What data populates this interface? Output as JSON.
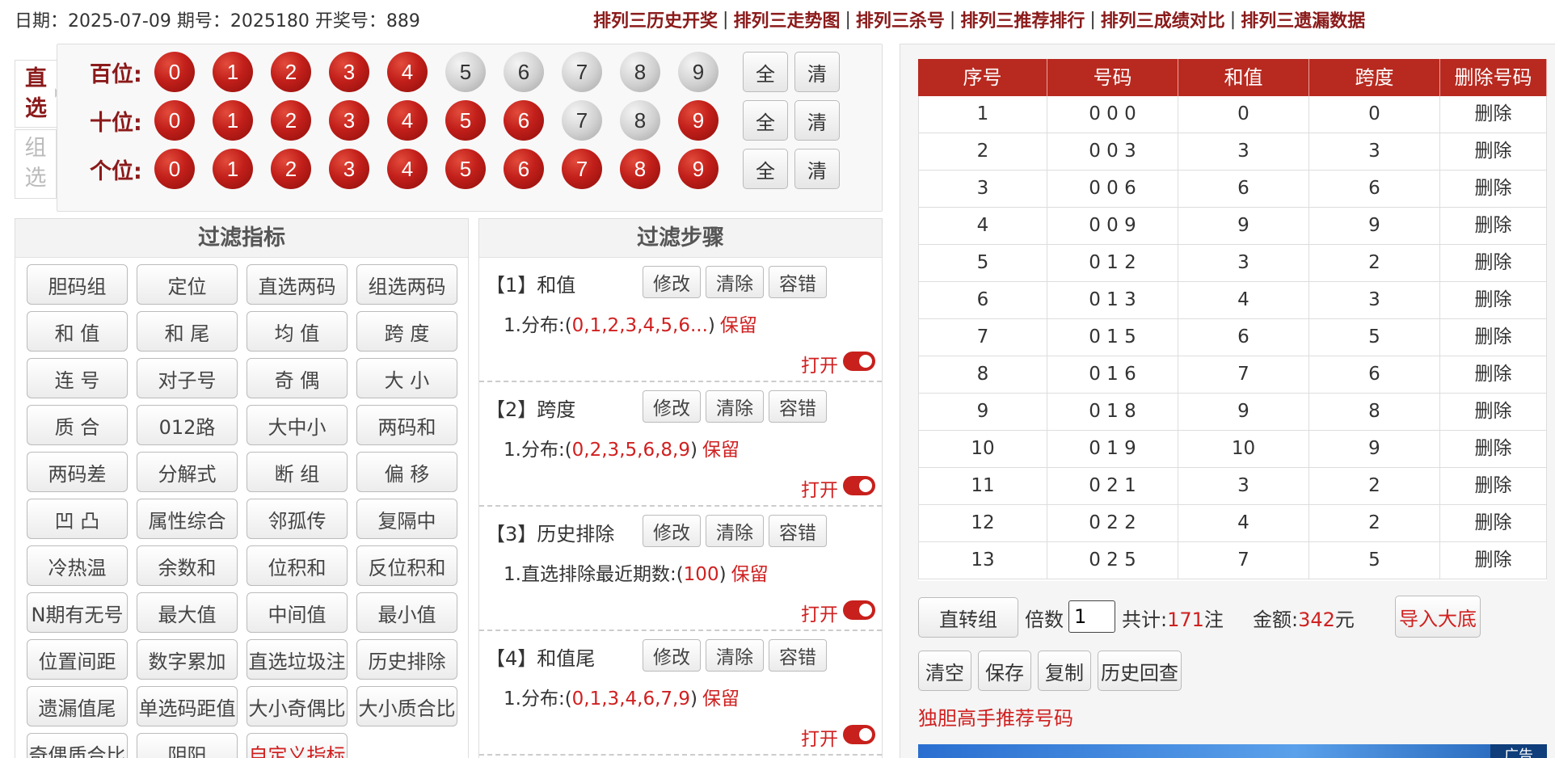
{
  "header": {
    "info": "日期：2025-07-09 期号：2025180 开奖号：889",
    "links": [
      "排列三历史开奖",
      "排列三走势图",
      "排列三杀号",
      "排列三推荐排行",
      "排列三成绩对比",
      "排列三遗漏数据"
    ]
  },
  "mode_tabs": {
    "direct": "直\n选",
    "group": "组\n选"
  },
  "picker": {
    "rows": [
      {
        "label": "百位:",
        "balls": [
          {
            "n": "0",
            "on": true
          },
          {
            "n": "1",
            "on": true
          },
          {
            "n": "2",
            "on": true
          },
          {
            "n": "3",
            "on": true
          },
          {
            "n": "4",
            "on": true
          },
          {
            "n": "5",
            "on": false
          },
          {
            "n": "6",
            "on": false
          },
          {
            "n": "7",
            "on": false
          },
          {
            "n": "8",
            "on": false
          },
          {
            "n": "9",
            "on": false
          }
        ]
      },
      {
        "label": "十位:",
        "balls": [
          {
            "n": "0",
            "on": true
          },
          {
            "n": "1",
            "on": true
          },
          {
            "n": "2",
            "on": true
          },
          {
            "n": "3",
            "on": true
          },
          {
            "n": "4",
            "on": true
          },
          {
            "n": "5",
            "on": true
          },
          {
            "n": "6",
            "on": true
          },
          {
            "n": "7",
            "on": false
          },
          {
            "n": "8",
            "on": false
          },
          {
            "n": "9",
            "on": true
          }
        ]
      },
      {
        "label": "个位:",
        "balls": [
          {
            "n": "0",
            "on": true
          },
          {
            "n": "1",
            "on": true
          },
          {
            "n": "2",
            "on": true
          },
          {
            "n": "3",
            "on": true
          },
          {
            "n": "4",
            "on": true
          },
          {
            "n": "5",
            "on": true
          },
          {
            "n": "6",
            "on": true
          },
          {
            "n": "7",
            "on": true
          },
          {
            "n": "8",
            "on": true
          },
          {
            "n": "9",
            "on": true
          }
        ]
      }
    ],
    "all_label": "全",
    "clear_label": "清"
  },
  "filter_index": {
    "title": "过滤指标",
    "buttons": [
      "胆码组",
      "定位",
      "直选两码",
      "组选两码",
      "和 值",
      "和 尾",
      "均 值",
      "跨 度",
      "连 号",
      "对子号",
      "奇 偶",
      "大 小",
      "质 合",
      "012路",
      "大中小",
      "两码和",
      "两码差",
      "分解式",
      "断 组",
      "偏 移",
      "凹 凸",
      "属性综合",
      "邻孤传",
      "复隔中",
      "冷热温",
      "余数和",
      "位积和",
      "反位积和",
      "N期有无号",
      "最大值",
      "中间值",
      "最小值",
      "位置间距",
      "数字累加",
      "直选垃圾注",
      "历史排除",
      "遗漏值尾",
      "单选码距值",
      "大小奇偶比",
      "大小质合比",
      "奇偶质合比",
      "阴阳",
      "自定义指标"
    ],
    "red_button": "自定义指标"
  },
  "filter_steps": {
    "title": "过滤步骤",
    "edit_label": "修改",
    "clear_label": "清除",
    "tolerance_label": "容错",
    "open_label": "打开",
    "keep_label": "保留",
    "steps": [
      {
        "title": "【1】和值",
        "rule_prefix": "1.分布:(",
        "rule_value": "0,1,2,3,4,5,6...",
        "rule_suffix": ")"
      },
      {
        "title": "【2】跨度",
        "rule_prefix": "1.分布:(",
        "rule_value": "0,2,3,5,6,8,9",
        "rule_suffix": ")"
      },
      {
        "title": "【3】历史排除",
        "rule_prefix": "1.直选排除最近期数:(",
        "rule_value": "100",
        "rule_suffix": ")"
      },
      {
        "title": "【4】和值尾",
        "rule_prefix": "1.分布:(",
        "rule_value": "0,1,3,4,6,7,9",
        "rule_suffix": ")"
      }
    ]
  },
  "table": {
    "headers": [
      "序号",
      "号码",
      "和值",
      "跨度",
      "删除号码"
    ],
    "delete_label": "删除",
    "rows": [
      [
        "1",
        "0 0 0",
        "0",
        "0"
      ],
      [
        "2",
        "0 0 3",
        "3",
        "3"
      ],
      [
        "3",
        "0 0 6",
        "6",
        "6"
      ],
      [
        "4",
        "0 0 9",
        "9",
        "9"
      ],
      [
        "5",
        "0 1 2",
        "3",
        "2"
      ],
      [
        "6",
        "0 1 3",
        "4",
        "3"
      ],
      [
        "7",
        "0 1 5",
        "6",
        "5"
      ],
      [
        "8",
        "0 1 6",
        "7",
        "6"
      ],
      [
        "9",
        "0 1 8",
        "9",
        "8"
      ],
      [
        "10",
        "0 1 9",
        "10",
        "9"
      ],
      [
        "11",
        "0 2 1",
        "3",
        "2"
      ],
      [
        "12",
        "0 2 2",
        "4",
        "2"
      ],
      [
        "13",
        "0 2 5",
        "7",
        "5"
      ]
    ]
  },
  "bottom": {
    "to_group": "直转组",
    "multiple_label": "倍数",
    "multiple_value": "1",
    "total_label": "共计:",
    "total_value": "171",
    "total_unit": "注",
    "amount_label": "金额:",
    "amount_value": "342",
    "amount_unit": "元",
    "import_label": "导入大底",
    "clear_btn": "清空",
    "save_btn": "保存",
    "copy_btn": "复制",
    "history_btn": "历史回查",
    "recommend_link": "独胆高手推荐号码",
    "ad_label": "广告"
  },
  "colors": {
    "brand_red": "#b8291f",
    "dark_red": "#8b1a1a",
    "accent_red": "#d02020"
  }
}
